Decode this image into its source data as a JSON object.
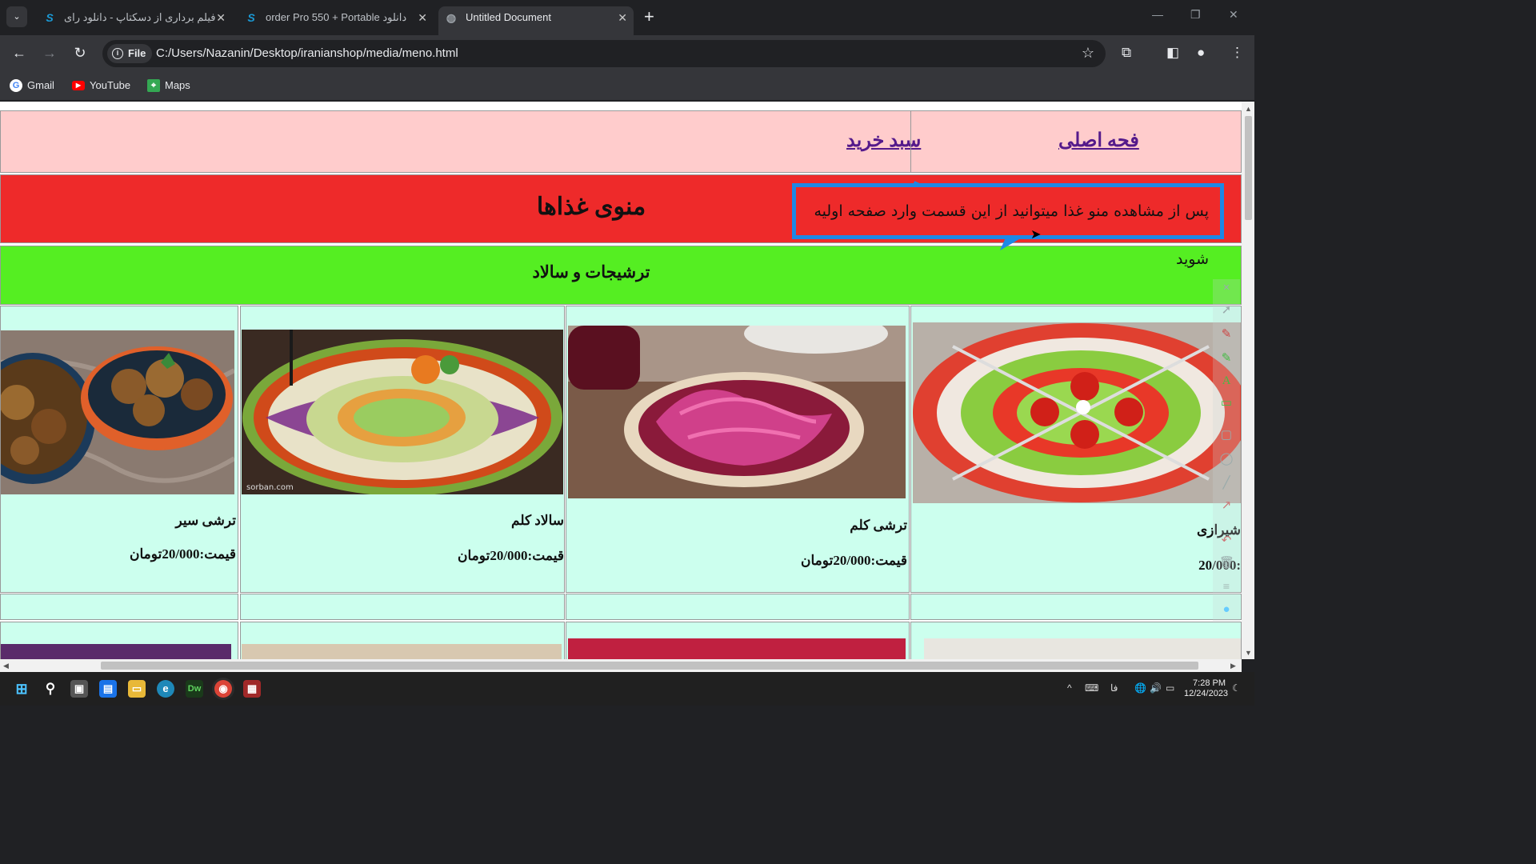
{
  "browser": {
    "tabs": [
      {
        "title": "فیلم برداری از دسکتاپ - دانلود رای",
        "favicon": "s-icon"
      },
      {
        "title": "order Pro 550 + Portable دانلود",
        "favicon": "s-icon"
      },
      {
        "title": "Untitled Document",
        "favicon": "globe-icon",
        "active": true
      }
    ],
    "address": {
      "chip": "File",
      "url": "C:/Users/Nazanin/Desktop/iranianshop/media/meno.html"
    },
    "bookmarks": [
      {
        "label": "Gmail",
        "icon": "google-icon"
      },
      {
        "label": "YouTube",
        "icon": "youtube-icon"
      },
      {
        "label": "Maps",
        "icon": "maps-icon"
      }
    ]
  },
  "page": {
    "nav": {
      "home_link": "فحه اصلی",
      "cart_link": "سبد خرید"
    },
    "menu_title": "منوی غذاها",
    "notice": "پس از مشاهده منو غذا میتوانید از این قسمت وارد صفحه اولیه شوید",
    "category_title": "ترشیجات و سالاد",
    "items": [
      {
        "name": "شیرازی",
        "price": ":20/000",
        "image": "shirazi-salad-photo"
      },
      {
        "name": "ترشی کلم",
        "price": "قیمت:20/000تومان",
        "image": "pickled-cabbage-photo"
      },
      {
        "name": "سالاد کلم",
        "price": "قیمت:20/000تومان",
        "image": "cabbage-salad-photo"
      },
      {
        "name": "ترشی سیر",
        "price": "قیمت:20/000تومان",
        "image": "pickled-garlic-photo"
      }
    ],
    "image_watermark": "sorban.com"
  },
  "taskbar": {
    "time": "7:28 PM",
    "date": "12/24/2023",
    "lang": "فا"
  },
  "colors": {
    "nav_bg": "#ffcccc",
    "title_bg": "#ee2a2a",
    "category_bg": "#55ee22",
    "card_bg": "#ccffee",
    "annotation_blue": "#1e88e5"
  }
}
